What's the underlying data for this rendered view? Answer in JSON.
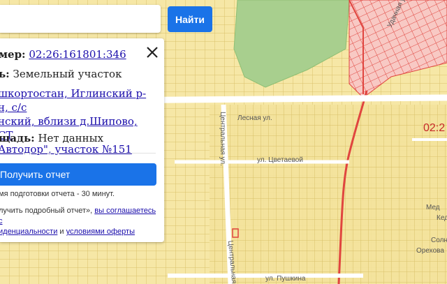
{
  "search": {
    "placeholder": "",
    "value": "",
    "button_label": "Найти"
  },
  "info": {
    "cad_label": "мер:",
    "cad_number": "02:26:161801:346",
    "type_label": "ь:",
    "type_value": "Земельный участок",
    "address_lines": [
      "шкортостан, Иглинский р-н, с/с",
      "нский, вблизи д.Шипово, СТ",
      "Автодор\", участок №151"
    ],
    "area_label": "щадь:",
    "area_value": "Нет данных",
    "report_button": "Получить отчет",
    "report_time_note": "мя подготовки отчета - 30 минут.",
    "agree_prefix": "лучить подробный отчет»,",
    "agree_link": "вы соглашаетесь с",
    "privacy_link": "иденциальности",
    "and_text": "и",
    "offer_link": "условиями оферты"
  },
  "map": {
    "streets": [
      "Лесная ул.",
      "ул. Цветаевой",
      "Центральная ул.",
      "Центральная ул.",
      "ул. Пушкина",
      "Удачная ул.",
      "Мед",
      "Кед",
      "Солн",
      "Орехова"
    ],
    "area_code": "02:2",
    "colors": {
      "parcel_fill": "#f6e7a6",
      "parcel_line": "#d9c06a",
      "forest": "#a8cf8e",
      "red_zone": "#f6b8b8",
      "red_line": "#e0453f",
      "road": "#ffffff"
    }
  }
}
